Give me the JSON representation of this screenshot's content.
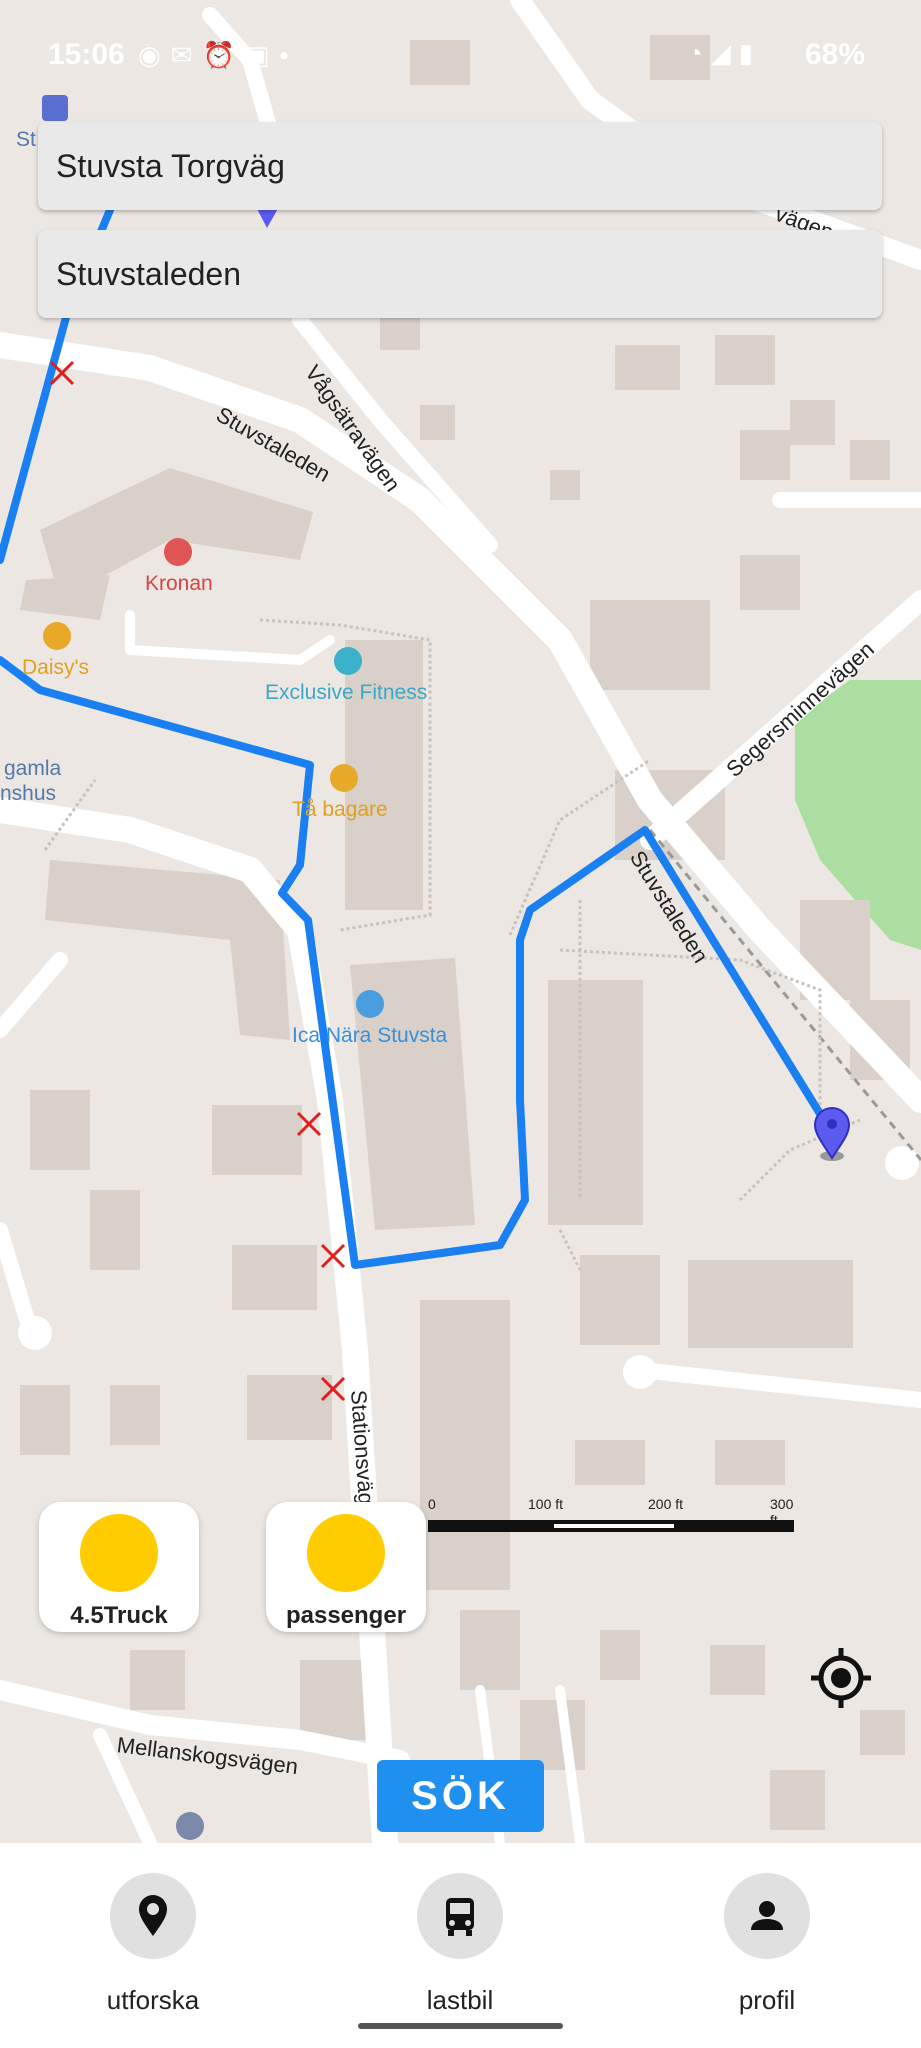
{
  "status_bar": {
    "time": "15:06",
    "battery": "68%",
    "left_icons": [
      "discord-icon",
      "gmail-icon",
      "alarm-icon",
      "photo-icon",
      "dot-icon"
    ],
    "right_icons": [
      "wifi-icon",
      "signal-icon",
      "battery-icon"
    ]
  },
  "search": {
    "origin_value": "Stuvsta Torgväg",
    "destination_value": "Stuvstaleden"
  },
  "map": {
    "pois": [
      {
        "name": "Kronan",
        "color": "#d64545"
      },
      {
        "name": "Daisy's",
        "color": "#e0a020"
      },
      {
        "name": "Exclusive Fitness",
        "color": "#3ba7c7"
      },
      {
        "name": "Tå bagare",
        "color": "#e0a020"
      },
      {
        "name": "Ica Nära Stuvsta",
        "color": "#3b8fd6"
      },
      {
        "name": "gamla",
        "color": "#5577aa"
      },
      {
        "name": "nshus",
        "color": "#5577aa"
      },
      {
        "name": "St",
        "color": "#5577aa"
      }
    ],
    "streets": [
      "Stuvstaleden",
      "Vågsätravägen",
      "Segersminnevägen",
      "Stuvstaleden",
      "Stationsväg",
      "Mellanskogsvägen",
      "vägen"
    ],
    "route_color": "#1a7ff0"
  },
  "scale_bar": {
    "labels": [
      "0",
      "100 ft",
      "200 ft",
      "300 ft"
    ]
  },
  "vehicles": [
    {
      "label": "4.5Truck",
      "color": "#ffcc00"
    },
    {
      "label": "passenger",
      "color": "#ffcc00"
    }
  ],
  "search_button": "SÖK",
  "nav": [
    {
      "label": "utforska",
      "icon": "location-pin-icon"
    },
    {
      "label": "lastbil",
      "icon": "bus-icon"
    },
    {
      "label": "profil",
      "icon": "person-icon"
    }
  ]
}
